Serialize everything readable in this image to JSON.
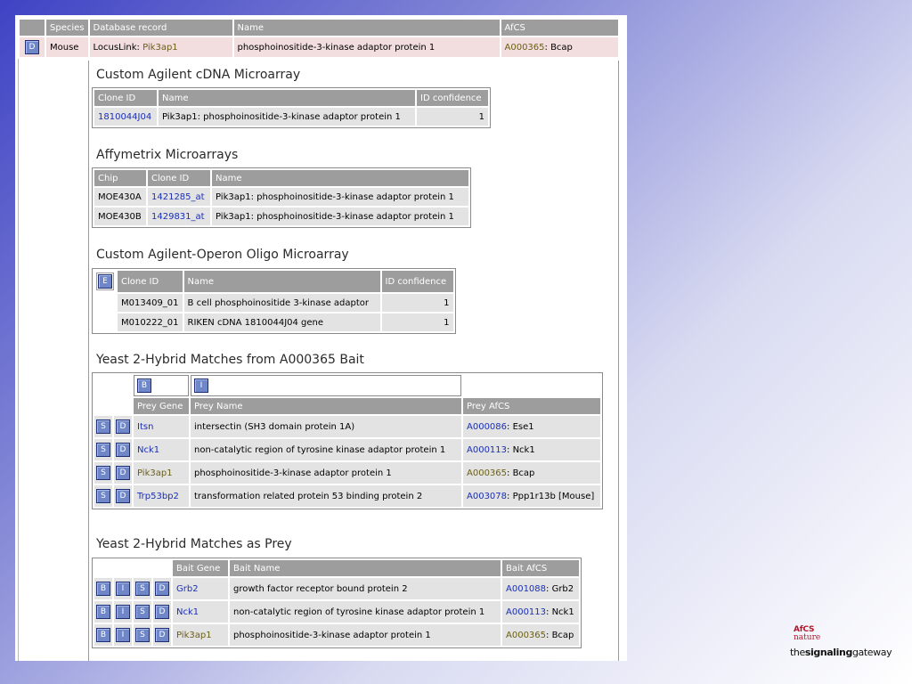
{
  "header": {
    "columns": [
      "Species",
      "Database record",
      "Name",
      "AfCS"
    ],
    "row": {
      "button": "D",
      "species": "Mouse",
      "record_prefix": "LocusLink: ",
      "record_link": "Pik3ap1",
      "name": "phosphoinositide-3-kinase adaptor protein 1",
      "afcs_link": "A000365",
      "afcs_suffix": ": Bcap"
    }
  },
  "agilent_cdna": {
    "title": "Custom Agilent cDNA Microarray",
    "columns": [
      "Clone ID",
      "Name",
      "ID confidence"
    ],
    "rows": [
      {
        "clone": "1810044J04",
        "name": "Pik3ap1: phosphoinositide-3-kinase adaptor protein 1",
        "confidence": "1"
      }
    ]
  },
  "affymetrix": {
    "title": "Affymetrix Microarrays",
    "columns": [
      "Chip",
      "Clone ID",
      "Name"
    ],
    "rows": [
      {
        "chip": "MOE430A",
        "clone": "1421285_at",
        "name": "Pik3ap1: phosphoinositide-3-kinase adaptor protein 1"
      },
      {
        "chip": "MOE430B",
        "clone": "1429831_at",
        "name": "Pik3ap1: phosphoinositide-3-kinase adaptor protein 1"
      }
    ]
  },
  "operon": {
    "title": "Custom Agilent-Operon Oligo Microarray",
    "button": "E",
    "columns": [
      "Clone ID",
      "Name",
      "ID confidence"
    ],
    "rows": [
      {
        "clone": "M013409_01",
        "name": "B cell phosphoinositide 3-kinase adaptor",
        "confidence": "1"
      },
      {
        "clone": "M010222_01",
        "name": "RIKEN cDNA 1810044J04 gene",
        "confidence": "1"
      }
    ]
  },
  "y2h_bait": {
    "title": "Yeast 2-Hybrid Matches from A000365 Bait",
    "top_buttons": [
      "B",
      "I"
    ],
    "row_buttons": [
      "S",
      "D"
    ],
    "columns": [
      "Prey Gene",
      "Prey Name",
      "Prey AfCS"
    ],
    "rows": [
      {
        "gene": "Itsn",
        "name": "intersectin (SH3 domain protein 1A)",
        "afcs": "A000086",
        "afcs_suffix": ": Ese1"
      },
      {
        "gene": "Nck1",
        "name": "non-catalytic region of tyrosine kinase adaptor protein 1",
        "afcs": "A000113",
        "afcs_suffix": ": Nck1"
      },
      {
        "gene": "Pik3ap1",
        "name": "phosphoinositide-3-kinase adaptor protein 1",
        "afcs": "A000365",
        "afcs_suffix": ": Bcap"
      },
      {
        "gene": "Trp53bp2",
        "name": "transformation related protein 53 binding protein 2",
        "afcs": "A003078",
        "afcs_suffix": ": Ppp1r13b [Mouse]"
      }
    ]
  },
  "y2h_prey": {
    "title": "Yeast 2-Hybrid Matches as Prey",
    "row_buttons": [
      "B",
      "I",
      "S",
      "D"
    ],
    "columns": [
      "Bait Gene",
      "Bait Name",
      "Bait AfCS"
    ],
    "rows": [
      {
        "gene": "Grb2",
        "name": "growth factor receptor bound protein 2",
        "afcs": "A001088",
        "afcs_suffix": ": Grb2"
      },
      {
        "gene": "Nck1",
        "name": "non-catalytic region of tyrosine kinase adaptor protein 1",
        "afcs": "A000113",
        "afcs_suffix": ": Nck1"
      },
      {
        "gene": "Pik3ap1",
        "name": "phosphoinositide-3-kinase adaptor protein 1",
        "afcs": "A000365",
        "afcs_suffix": ": Bcap"
      }
    ]
  },
  "logo": {
    "line1": "AfCS",
    "line2": "nature",
    "brand_a": "the",
    "brand_b": "signaling",
    "brand_c": "gateway"
  },
  "colors": {
    "header_bg": "#9d9d9d",
    "cell_bg": "#e3e3e3",
    "link_blue": "#1a2fb5",
    "link_gold": "#6b5e14",
    "button_blue": "#6f87c9",
    "highlight_row": "#f2dede"
  }
}
